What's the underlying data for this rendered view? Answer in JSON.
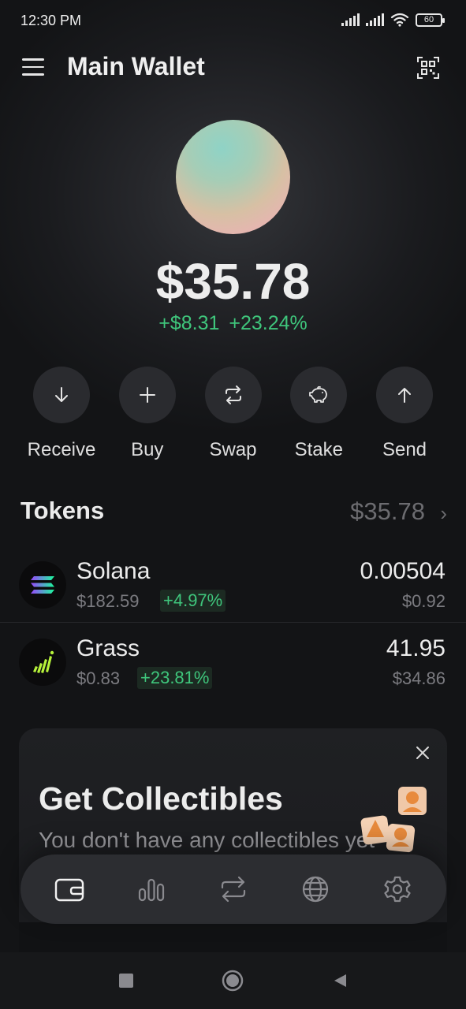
{
  "status_bar": {
    "time": "12:30 PM",
    "battery": "60"
  },
  "header": {
    "title": "Main Wallet"
  },
  "balance": {
    "total": "$35.78",
    "change_amount": "+$8.31",
    "change_percent": "+23.24%"
  },
  "actions": [
    {
      "label": "Receive",
      "icon": "arrow-down-icon"
    },
    {
      "label": "Buy",
      "icon": "plus-icon"
    },
    {
      "label": "Swap",
      "icon": "swap-icon"
    },
    {
      "label": "Stake",
      "icon": "piggy-bank-icon"
    },
    {
      "label": "Send",
      "icon": "arrow-up-icon"
    }
  ],
  "tokens": {
    "title": "Tokens",
    "total": "$35.78",
    "items": [
      {
        "name": "Solana",
        "price": "$182.59",
        "change": "+4.97%",
        "amount": "0.00504",
        "value": "$0.92",
        "icon": "solana-logo-icon"
      },
      {
        "name": "Grass",
        "price": "$0.83",
        "change": "+23.81%",
        "amount": "41.95",
        "value": "$34.86",
        "icon": "grass-logo-icon"
      }
    ]
  },
  "collectibles_card": {
    "title": "Get Collectibles",
    "subtitle": "You don't have any collectibles yet"
  },
  "bottom_nav": [
    {
      "icon": "wallet-icon",
      "active": true
    },
    {
      "icon": "chart-icon",
      "active": false
    },
    {
      "icon": "swap-icon",
      "active": false
    },
    {
      "icon": "globe-icon",
      "active": false
    },
    {
      "icon": "settings-icon",
      "active": false
    }
  ],
  "colors": {
    "positive": "#3fc67c",
    "background": "#131416",
    "accent_text": "#ececec"
  }
}
